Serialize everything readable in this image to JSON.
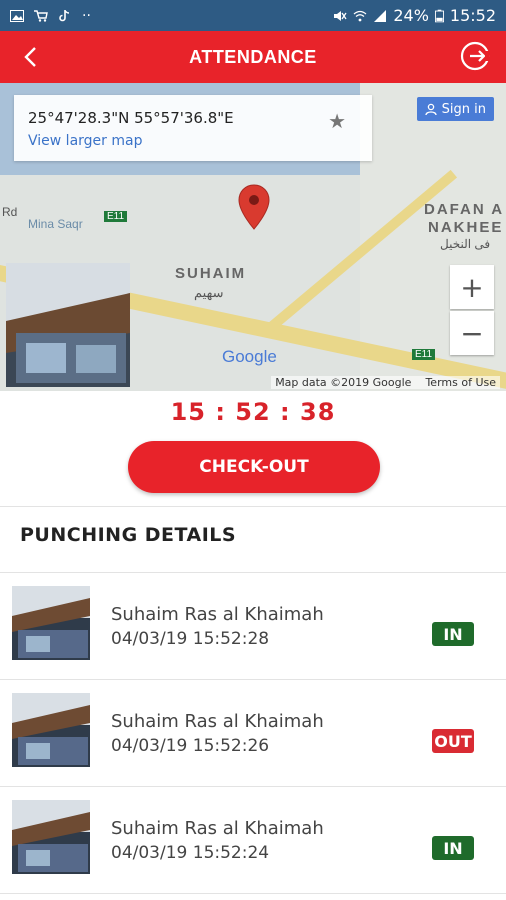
{
  "status_bar": {
    "battery": "24%",
    "time": "15:52"
  },
  "app_bar": {
    "title": "ATTENDANCE"
  },
  "map": {
    "coordinates": "25°47'28.3\"N 55°57'36.8\"E",
    "view_larger_map": "View larger map",
    "sign_in": "Sign in",
    "area_label": "SUHAIM",
    "area_label_ar": "سهيم",
    "dafan_label_1": "DAFAN A",
    "dafan_label_2": "NAKHEE",
    "dafan_label_ar": "فى النخيل",
    "mina_label": "Mina Saqr",
    "rd_label": "Rd",
    "e11_label": "E11",
    "google_logo": "Google",
    "attribution_data": "Map data ©2019 Google",
    "attribution_terms": "Terms of Use",
    "zoom_in": "+",
    "zoom_out": "−"
  },
  "clock": {
    "time": "15 : 52 : 38"
  },
  "checkout_button": {
    "label": "CHECK-OUT"
  },
  "punching": {
    "title": "PUNCHING DETAILS",
    "entries": [
      {
        "location": "Suhaim Ras al Khaimah",
        "timestamp": "04/03/19 15:52:28",
        "type": "IN"
      },
      {
        "location": "Suhaim Ras al Khaimah",
        "timestamp": "04/03/19 15:52:26",
        "type": "OUT"
      },
      {
        "location": "Suhaim Ras al Khaimah",
        "timestamp": "04/03/19 15:52:24",
        "type": "IN"
      }
    ]
  },
  "colors": {
    "primary": "#e8232a",
    "status_bar": "#2e5b84",
    "badge_in": "#1f6b2b",
    "badge_out": "#d92b33"
  }
}
